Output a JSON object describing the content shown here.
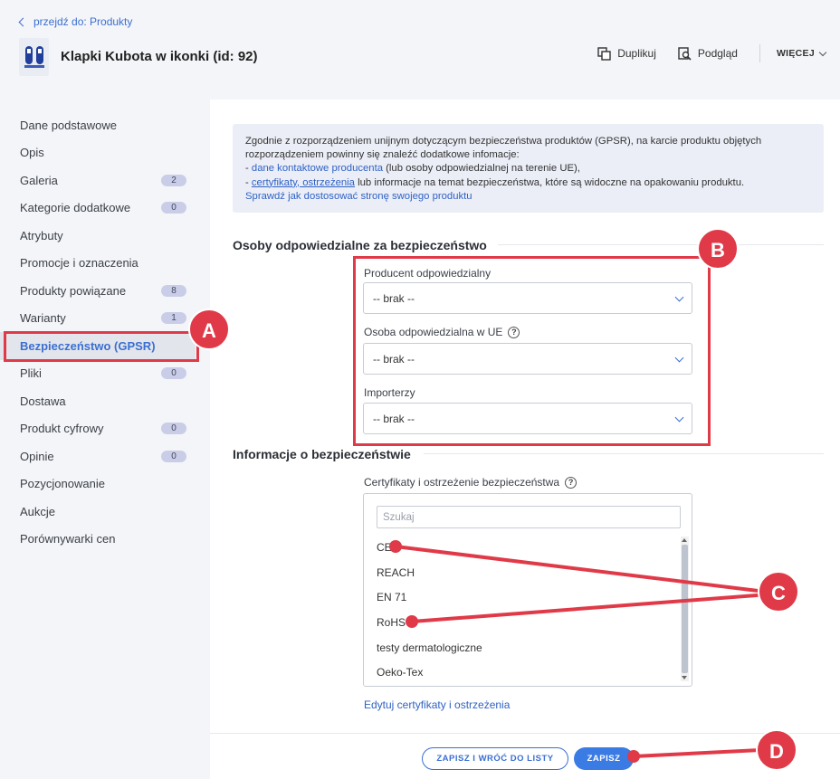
{
  "breadcrumb": {
    "label": "przejdź do: Produkty"
  },
  "product": {
    "title": "Klapki Kubota w ikonki (id: 92)"
  },
  "toolbar": {
    "duplicate": "Duplikuj",
    "preview": "Podgląd",
    "more": "WIĘCEJ"
  },
  "sidebar": {
    "items": [
      {
        "label": "Dane podstawowe",
        "badge": null
      },
      {
        "label": "Opis",
        "badge": null
      },
      {
        "label": "Galeria",
        "badge": "2"
      },
      {
        "label": "Kategorie dodatkowe",
        "badge": "0"
      },
      {
        "label": "Atrybuty",
        "badge": null
      },
      {
        "label": "Promocje i oznaczenia",
        "badge": null
      },
      {
        "label": "Produkty powiązane",
        "badge": "8"
      },
      {
        "label": "Warianty",
        "badge": "1"
      },
      {
        "label": "Bezpieczeństwo (GPSR)",
        "badge": null,
        "active": true
      },
      {
        "label": "Pliki",
        "badge": "0"
      },
      {
        "label": "Dostawa",
        "badge": null
      },
      {
        "label": "Produkt cyfrowy",
        "badge": "0"
      },
      {
        "label": "Opinie",
        "badge": "0"
      },
      {
        "label": "Pozycjonowanie",
        "badge": null
      },
      {
        "label": "Aukcje",
        "badge": null
      },
      {
        "label": "Porównywarki cen",
        "badge": null
      }
    ]
  },
  "notice": {
    "line1": "Zgodnie z rozporządzeniem unijnym dotyczącym bezpieczeństwa produktów (GPSR), na karcie produktu objętych rozporządzeniem powinny się znaleźć dodatkowe infomacje:",
    "bullet1_prefix": "- ",
    "bullet1_link": "dane kontaktowe producenta",
    "bullet1_rest": " (lub osoby odpowiedzialnej na terenie UE),",
    "bullet2_prefix": "- ",
    "bullet2_link": "certyfikaty, ostrzeżenia",
    "bullet2_rest": " lub informacje na temat bezpieczeństwa, które są widoczne na opakowaniu produktu.",
    "help_link": "Sprawdź jak dostosować stronę swojego produktu"
  },
  "responsible": {
    "title": "Osoby odpowiedzialne za bezpieczeństwo",
    "producer_label": "Producent odpowiedzialny",
    "producer_value": "-- brak --",
    "eu_label": "Osoba odpowiedzialna w UE",
    "eu_value": "-- brak --",
    "importers_label": "Importerzy",
    "importers_value": "-- brak --"
  },
  "safety": {
    "title": "Informacje o bezpieczeństwie",
    "cert_label": "Certyfikaty i ostrzeżenie bezpieczeństwa",
    "search_placeholder": "Szukaj",
    "options": [
      "CE",
      "REACH",
      "EN 71",
      "RoHS",
      "testy dermatologiczne",
      "Oeko-Tex"
    ],
    "edit_link": "Edytuj certyfikaty i ostrzeżenia"
  },
  "footer": {
    "save_back": "ZAPISZ I WRÓĆ DO LISTY",
    "save": "ZAPISZ"
  },
  "annotations": {
    "a": "A",
    "b": "B",
    "c": "C",
    "d": "D",
    "color": "#e03a48"
  },
  "colors": {
    "accent": "#3b6fd1",
    "primary_button": "#3b7be4"
  }
}
